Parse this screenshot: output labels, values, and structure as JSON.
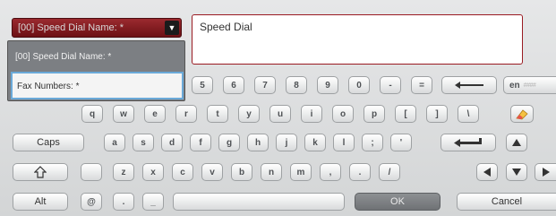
{
  "field_selector": {
    "label": "[00] Speed Dial Name: *",
    "arrow_icon": "caret-down-icon"
  },
  "text_box": {
    "value": "Speed Dial"
  },
  "dropdown": {
    "options": [
      "[00] Speed Dial Name: *",
      "Fax Numbers: *"
    ],
    "selected_index": 1
  },
  "keyboard": {
    "row1": [
      "5",
      "6",
      "7",
      "8",
      "9",
      "0",
      "-",
      "="
    ],
    "row2": [
      "q",
      "w",
      "e",
      "r",
      "t",
      "y",
      "u",
      "i",
      "o",
      "p",
      "[",
      "]",
      "\\"
    ],
    "row3": [
      "a",
      "s",
      "d",
      "f",
      "g",
      "h",
      "j",
      "k",
      "l",
      ";",
      "'"
    ],
    "row4": [
      "z",
      "x",
      "c",
      "v",
      "b",
      "n",
      "m",
      ",",
      ".",
      "/"
    ],
    "caps_label": "Caps",
    "alt_label": "Alt",
    "at_label": "@",
    "dot_label": ".",
    "underscore_label": "_",
    "lang_label": "en",
    "lang_hint": "####",
    "ok_label": "OK",
    "cancel_label": "Cancel"
  },
  "icons": [
    "backspace-icon",
    "eraser-icon",
    "enter-icon",
    "arrow-up-icon",
    "shift-icon",
    "arrow-left-icon",
    "arrow-down-icon",
    "arrow-right-icon"
  ],
  "colors": {
    "selector_bg": "#7a161b",
    "text_box_border": "#9a1b22",
    "dropdown_bg": "#7c7f83",
    "highlight_border": "#6aa9d8"
  }
}
